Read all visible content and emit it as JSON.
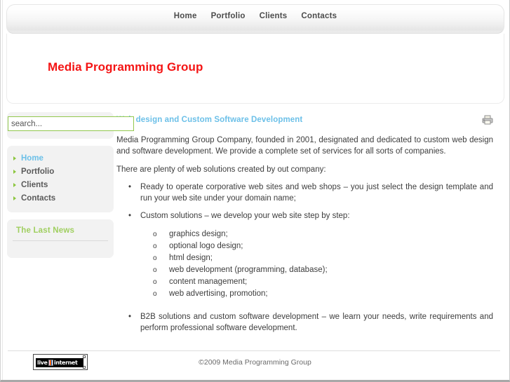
{
  "nav": {
    "items": [
      {
        "label": "Home"
      },
      {
        "label": "Portfolio"
      },
      {
        "label": "Clients"
      },
      {
        "label": "Contacts"
      }
    ]
  },
  "masthead": {
    "logo": "Media Programming Group",
    "logo_color": "#f41414"
  },
  "sidebar": {
    "search": {
      "value": "",
      "placeholder": "search...",
      "border_color": "#92c84e"
    },
    "menu": [
      {
        "label": "Home",
        "active": true
      },
      {
        "label": "Portfolio",
        "active": false
      },
      {
        "label": "Clients",
        "active": false
      },
      {
        "label": "Contacts",
        "active": false
      }
    ],
    "news": {
      "title": "The Last News",
      "title_color": "#a0cf60"
    }
  },
  "content": {
    "title": "Web design and Custom Software Development",
    "title_color": "#6cc0e8",
    "print_icon": "printer-icon",
    "paragraph_1": "Media Programming Group Company, founded in 2001, designated and dedicated to custom web design and software development.  We provide a complete set of services for all sorts of companies.",
    "paragraph_2": "There are plenty of web solutions created by out company:",
    "bullets": [
      "Ready to operate corporative web sites and web shops – you just select the design template and run your web site under  your domain name;",
      "Custom solutions – we develop your web site step by step:"
    ],
    "sub_items": [
      "graphics design;",
      "optional logo design;",
      "html design;",
      "web development (programming, database);",
      "content management;",
      "web advertising, promotion;"
    ],
    "bullet_last": "B2B solutions and custom software development – we learn your needs, write requirements and perform professional software development.",
    "bullet_char": "•",
    "sub_bullet_char": "o"
  },
  "footer": {
    "counter": {
      "live_text": "live",
      "internet_text": "internet"
    },
    "copyright": "©2009 Media Programming Group"
  }
}
